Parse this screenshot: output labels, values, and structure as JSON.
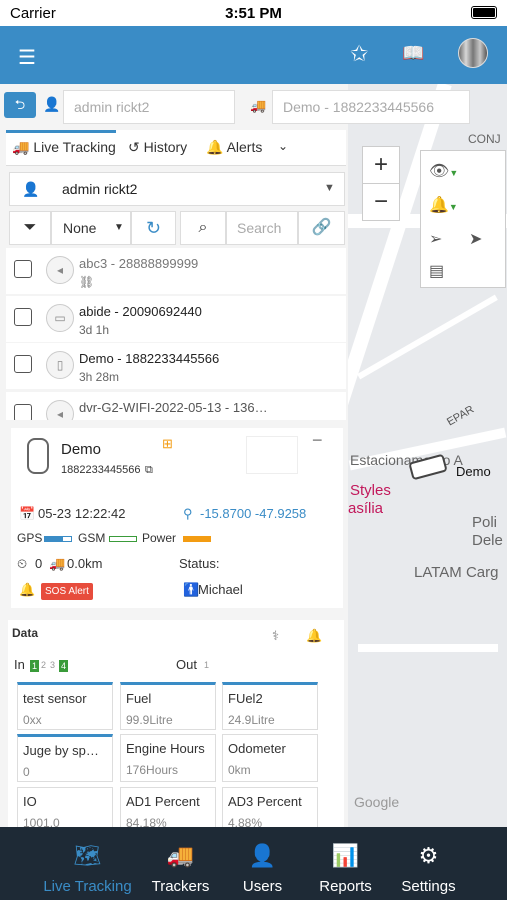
{
  "status_bar": {
    "carrier": "Carrier",
    "time": "3:51 PM"
  },
  "header": {
    "menu_icon": "menu-icon",
    "star_icon": "star-icon",
    "book_icon": "book-icon"
  },
  "top_inputs": {
    "user": "admin rickt2",
    "device": "Demo - 1882233445566"
  },
  "tabs": {
    "live": "Live Tracking",
    "history": "History",
    "alerts": "Alerts"
  },
  "user_select": "admin rickt2",
  "filter": {
    "value": "None",
    "search_placeholder": "Search"
  },
  "trackers": [
    {
      "name": "abc3 - 28888899999",
      "sub": ""
    },
    {
      "name": "abide - 20090692440",
      "sub": "3d 1h"
    },
    {
      "name": "Demo - 1882233445566",
      "sub": "3h 28m"
    },
    {
      "name": "dvr-G2-WIFI-2022-05-13 - 136…",
      "sub": ""
    }
  ],
  "detail": {
    "name": "Demo",
    "id": "1882233445566",
    "datetime": "05-23 12:22:42",
    "coords": "-15.8700 -47.9258",
    "gps": "GPS",
    "gsm": "GSM",
    "power": "Power",
    "speed": "0",
    "distance": "0.0km",
    "status_label": "Status:",
    "sos": "SOS Alert",
    "driver": "Michael"
  },
  "data_section": {
    "title": "Data",
    "in_label": "In",
    "in_nums": [
      "1",
      "2",
      "3",
      "4"
    ],
    "out_label": "Out",
    "out_num": "1",
    "sensors": [
      {
        "t": "test sensor",
        "v": "0xx"
      },
      {
        "t": "Fuel",
        "v": "99.9Litre"
      },
      {
        "t": "FUel2",
        "v": "24.9Litre"
      },
      {
        "t": "Juge by sp…",
        "v": "0"
      },
      {
        "t": "Engine Hours",
        "v": "176Hours"
      },
      {
        "t": "Odometer",
        "v": "0km"
      },
      {
        "t": "IO",
        "v": "1001.0"
      },
      {
        "t": "AD1 Percent",
        "v": "84.18%"
      },
      {
        "t": "AD3 Percent",
        "v": "4.88%"
      }
    ]
  },
  "map": {
    "labels": [
      "CONJ",
      "Estacionamento A",
      "Styles",
      "asília",
      "Poli",
      "Dele",
      "LATAM Carg",
      "EPAR",
      "Demo",
      "Google"
    ],
    "zoom_in": "+",
    "zoom_out": "−"
  },
  "bottom_nav": [
    {
      "label": "Live Tracking",
      "icon": "map-icon"
    },
    {
      "label": "Trackers",
      "icon": "truck-icon"
    },
    {
      "label": "Users",
      "icon": "user-icon"
    },
    {
      "label": "Reports",
      "icon": "chart-icon"
    },
    {
      "label": "Settings",
      "icon": "gear-icon"
    }
  ],
  "colors": {
    "header": "#3a8cc6",
    "nav_bg": "#1e2a36",
    "sos": "#e74c3c",
    "accent": "#3a8cc6"
  }
}
